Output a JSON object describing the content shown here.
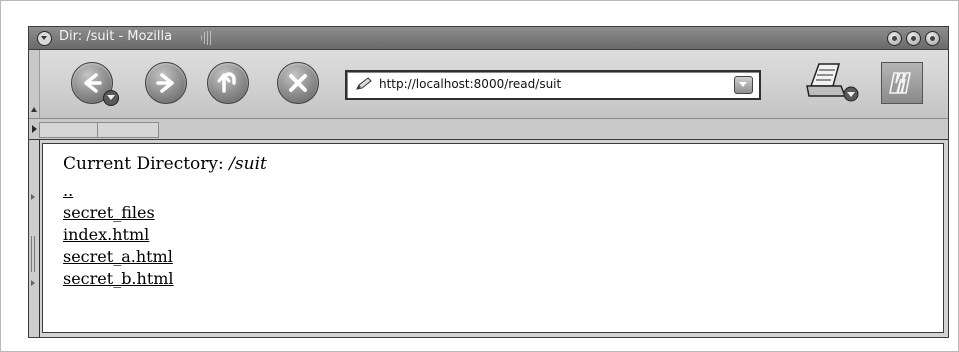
{
  "window": {
    "title": "Dir: /suit - Mozilla"
  },
  "toolbar": {
    "back_icon": "back-arrow-icon",
    "forward_icon": "forward-arrow-icon",
    "reload_icon": "reload-icon",
    "stop_icon": "stop-icon",
    "url": "http://localhost:8000/read/suit",
    "print_icon": "print-icon",
    "logo": "mozilla-logo"
  },
  "page": {
    "heading_label": "Current Directory:",
    "heading_path": "/suit",
    "links": [
      {
        "label": ".."
      },
      {
        "label": "secret_files"
      },
      {
        "label": "index.html"
      },
      {
        "label": "secret_a.html"
      },
      {
        "label": "secret_b.html"
      }
    ]
  },
  "colors": {
    "titlebar": "#7a7a7a",
    "toolbar": "#d2d2d2",
    "content_bg": "#ffffff"
  }
}
